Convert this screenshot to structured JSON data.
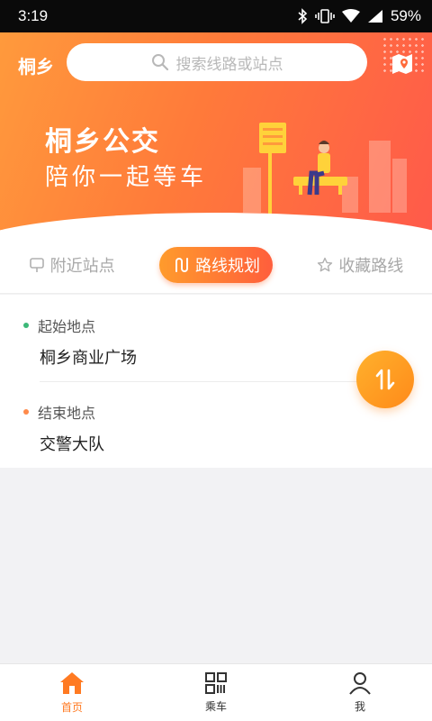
{
  "status_bar": {
    "time": "3:19",
    "battery": "59%"
  },
  "header": {
    "city": "桐乡",
    "search_placeholder": "搜索线路或站点"
  },
  "hero": {
    "title": "桐乡公交",
    "subtitle": "陪你一起等车"
  },
  "tabs": [
    {
      "label": "附近站点",
      "icon": "bus-stop-icon",
      "active": false
    },
    {
      "label": "路线规划",
      "icon": "route-icon",
      "active": true
    },
    {
      "label": "收藏路线",
      "icon": "star-icon",
      "active": false
    }
  ],
  "route": {
    "start_label": "起始地点",
    "start_value": "桐乡商业广场",
    "end_label": "结束地点",
    "end_value": "交警大队"
  },
  "bottom_nav": [
    {
      "label": "首页",
      "icon": "home-icon",
      "active": true
    },
    {
      "label": "乘车",
      "icon": "qr-code-icon",
      "active": false
    },
    {
      "label": "我",
      "icon": "person-icon",
      "active": false
    }
  ],
  "colors": {
    "accent": "#ff7a22",
    "start_dot": "#3cb878",
    "end_dot": "#ff8a4a"
  }
}
